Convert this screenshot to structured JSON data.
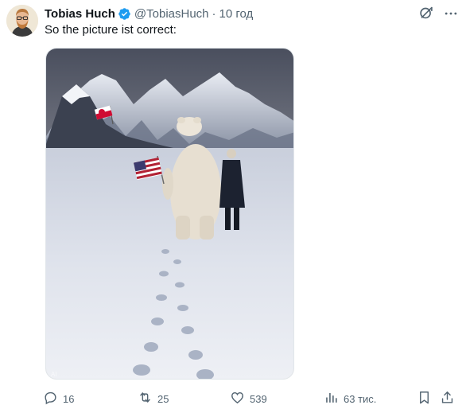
{
  "author": {
    "display_name": "Tobias Huch",
    "handle": "@TobiasHuch",
    "separator": "·",
    "time": "10 год",
    "verified": true,
    "verified_color": "#1d9bf0"
  },
  "post": {
    "text": "So the picture ist correct:"
  },
  "media": {
    "icon": "photo",
    "watermark_text": "AI"
  },
  "actions": {
    "reply": {
      "icon": "reply-icon",
      "count": "16"
    },
    "retweet": {
      "icon": "retweet-icon",
      "count": "25"
    },
    "like": {
      "icon": "heart-icon",
      "count": "539"
    },
    "views": {
      "icon": "views-icon",
      "count": "63 тис."
    },
    "bookmark": {
      "icon": "bookmark-icon"
    },
    "share": {
      "icon": "share-icon"
    }
  },
  "colors": {
    "text_primary": "#0f1419",
    "text_secondary": "#536471",
    "accent": "#1d9bf0"
  }
}
